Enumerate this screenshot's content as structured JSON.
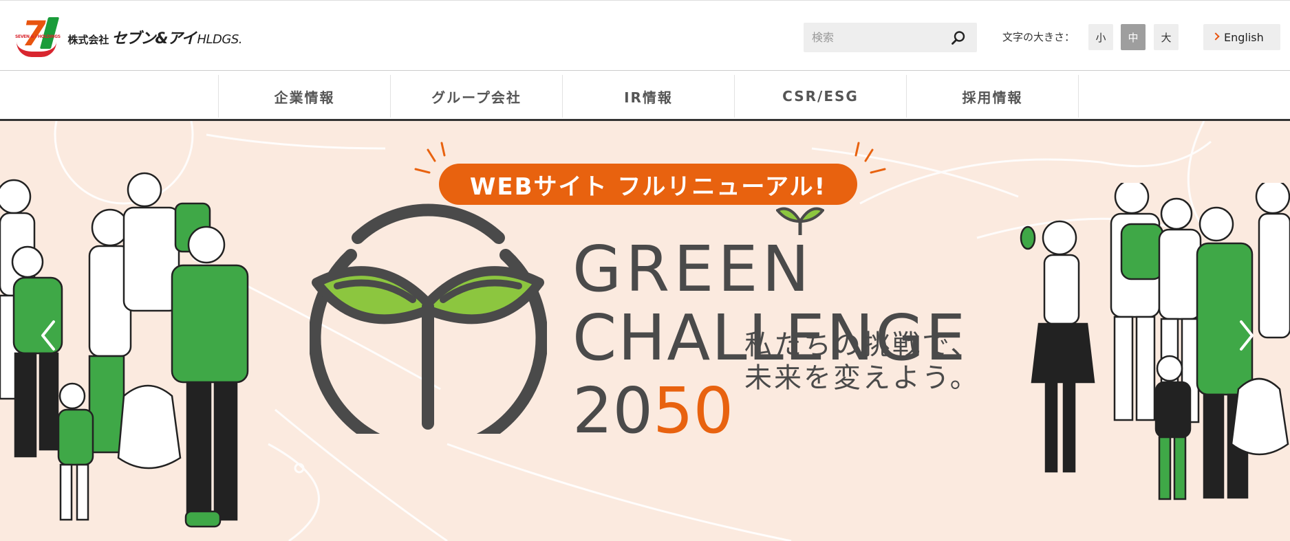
{
  "header": {
    "logo_small": "SEVEN & i HOLDINGS",
    "logo_prefix": "株式会社",
    "logo_name": "セブン&アイ",
    "logo_suffix": "HLDGS.",
    "search_placeholder": "検索",
    "font_size_label": "文字の大きさ：",
    "font_sizes": [
      "小",
      "中",
      "大"
    ],
    "font_size_selected": "中",
    "english_label": "English"
  },
  "nav": {
    "items": [
      "企業情報",
      "グループ会社",
      "IR情報",
      "CSR/ESG",
      "採用情報"
    ]
  },
  "hero": {
    "banner": "WEBサイト フルリニューアル!",
    "title_line1": "GREEN",
    "title_line2": "CHALLENGE",
    "year_part1": "20",
    "year_part2": "50",
    "tagline_line1": "私たちの挑戦で、",
    "tagline_line2": "未来を変えよう。"
  },
  "colors": {
    "accent_orange": "#e8620f",
    "leaf_green": "#8cc63f",
    "brand_green": "#1a9c3a",
    "hero_bg": "#fbeadf"
  }
}
